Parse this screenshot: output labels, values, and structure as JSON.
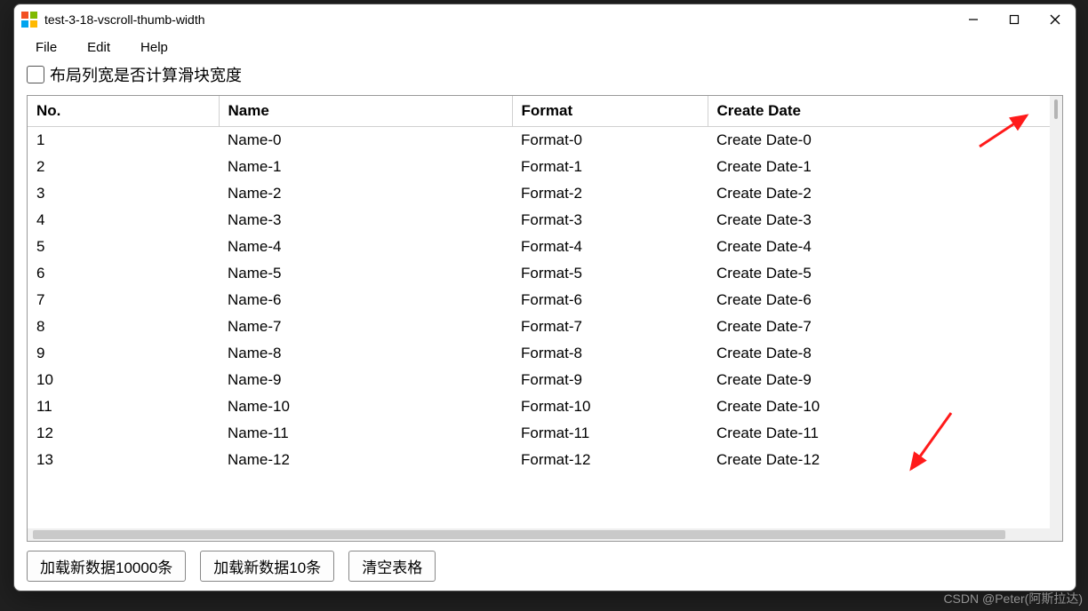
{
  "window": {
    "title": "test-3-18-vscroll-thumb-width"
  },
  "menu": {
    "file": "File",
    "edit": "Edit",
    "help": "Help"
  },
  "checkbox_label": "布局列宽是否计算滑块宽度",
  "columns": {
    "no": "No.",
    "name": "Name",
    "format": "Format",
    "date": "Create Date"
  },
  "rows": [
    {
      "no": "1",
      "name": "Name-0",
      "format": "Format-0",
      "date": "Create Date-0"
    },
    {
      "no": "2",
      "name": "Name-1",
      "format": "Format-1",
      "date": "Create Date-1"
    },
    {
      "no": "3",
      "name": "Name-2",
      "format": "Format-2",
      "date": "Create Date-2"
    },
    {
      "no": "4",
      "name": "Name-3",
      "format": "Format-3",
      "date": "Create Date-3"
    },
    {
      "no": "5",
      "name": "Name-4",
      "format": "Format-4",
      "date": "Create Date-4"
    },
    {
      "no": "6",
      "name": "Name-5",
      "format": "Format-5",
      "date": "Create Date-5"
    },
    {
      "no": "7",
      "name": "Name-6",
      "format": "Format-6",
      "date": "Create Date-6"
    },
    {
      "no": "8",
      "name": "Name-7",
      "format": "Format-7",
      "date": "Create Date-7"
    },
    {
      "no": "9",
      "name": "Name-8",
      "format": "Format-8",
      "date": "Create Date-8"
    },
    {
      "no": "10",
      "name": "Name-9",
      "format": "Format-9",
      "date": "Create Date-9"
    },
    {
      "no": "11",
      "name": "Name-10",
      "format": "Format-10",
      "date": "Create Date-10"
    },
    {
      "no": "12",
      "name": "Name-11",
      "format": "Format-11",
      "date": "Create Date-11"
    },
    {
      "no": "13",
      "name": "Name-12",
      "format": "Format-12",
      "date": "Create Date-12"
    }
  ],
  "buttons": {
    "load10000": "加载新数据10000条",
    "load10": "加载新数据10条",
    "clear": "清空表格"
  },
  "watermark": "CSDN @Peter(阿斯拉达)"
}
